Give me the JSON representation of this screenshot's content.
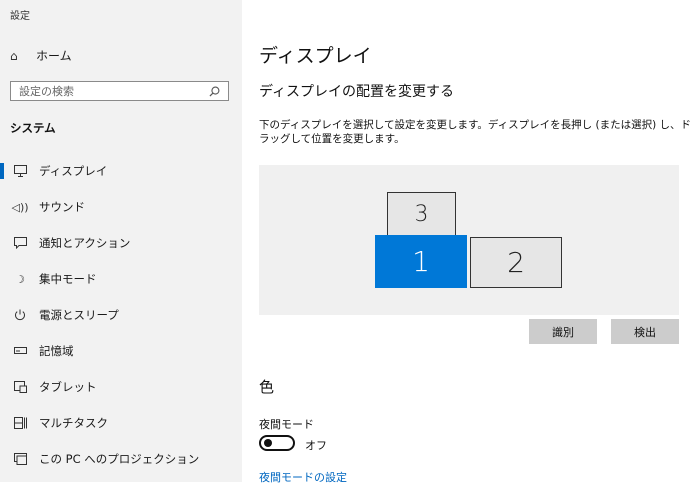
{
  "app_title": "設定",
  "sidebar": {
    "home_label": "ホーム",
    "search_placeholder": "設定の検索",
    "section_title": "システム",
    "items": [
      {
        "label": "ディスプレイ",
        "icon": "monitor-icon",
        "active": true
      },
      {
        "label": "サウンド",
        "icon": "speaker-icon"
      },
      {
        "label": "通知とアクション",
        "icon": "notification-icon"
      },
      {
        "label": "集中モード",
        "icon": "moon-icon"
      },
      {
        "label": "電源とスリープ",
        "icon": "power-icon"
      },
      {
        "label": "記憶域",
        "icon": "storage-icon"
      },
      {
        "label": "タブレット",
        "icon": "tablet-icon"
      },
      {
        "label": "マルチタスク",
        "icon": "multitask-icon"
      },
      {
        "label": "この PC へのプロジェクション",
        "icon": "projection-icon"
      }
    ]
  },
  "main": {
    "title": "ディスプレイ",
    "subtitle": "ディスプレイの配置を変更する",
    "description": "下のディスプレイを選択して設定を変更します。ディスプレイを長押し (または選択) し、ドラッグして位置を変更します。",
    "monitors": [
      {
        "label": "3",
        "selected": false
      },
      {
        "label": "1",
        "selected": true
      },
      {
        "label": "2",
        "selected": false
      }
    ],
    "identify_button": "識別",
    "detect_button": "検出",
    "color_section_title": "色",
    "night_light_label": "夜間モード",
    "night_light_state": "オフ",
    "night_light_link": "夜間モードの設定"
  },
  "colors": {
    "accent": "#0078d7",
    "sidebar_bg": "#f2f2f2",
    "arrangement_bg": "#f0f0f0"
  }
}
